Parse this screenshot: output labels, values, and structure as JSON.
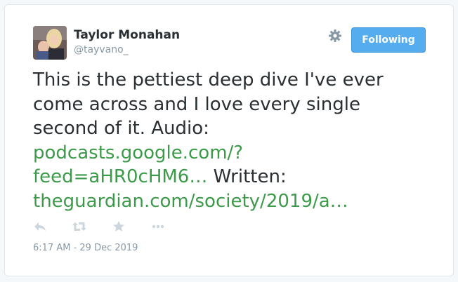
{
  "tweet": {
    "author": {
      "name": "Taylor Monahan",
      "handle": "@tayvano_"
    },
    "follow_button": {
      "label": "Following"
    },
    "text": {
      "line_intro": "This is the pettiest deep dive I've ever come across and I love every single second of it. Audio:",
      "link_audio_line1": "podcasts.google.com/?",
      "link_audio_line2": "feed=aHR0cHM6…",
      "word_written": "Written:",
      "link_written": "theguardian.com/society/2019/a…"
    },
    "timestamp": "6:17 AM - 29 Dec 2019",
    "actions": [
      "reply-icon",
      "retweet-icon",
      "like-icon",
      "more-icon"
    ]
  },
  "colors": {
    "link": "#3b9b48",
    "text": "#292f33",
    "muted": "#8899a6",
    "button": "#55acee",
    "action_icon": "#ccd6dd"
  }
}
